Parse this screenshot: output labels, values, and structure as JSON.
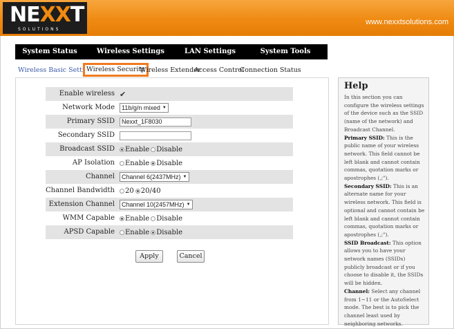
{
  "header": {
    "logo_main": "NE",
    "logo_x": "XX",
    "logo_end": "T",
    "logo_sub": "SOLUTIONS",
    "url": "www.nexxtsolutions.com"
  },
  "main_nav": [
    "System Status",
    "Wireless Settings",
    "LAN Settings",
    "System Tools"
  ],
  "sub_nav": [
    "Wireless Basic Settings",
    "Wireless Security",
    "Wireless Extender",
    "Access Control",
    "Connection Status"
  ],
  "form": {
    "enable_wireless": {
      "label": "Enable wireless",
      "checked": "✔"
    },
    "network_mode": {
      "label": "Network Mode",
      "value": "11b/g/n mixed"
    },
    "primary_ssid": {
      "label": "Primary SSID",
      "value": "Nexxt_1F8030"
    },
    "secondary_ssid": {
      "label": "Secondary SSID",
      "value": ""
    },
    "broadcast_ssid": {
      "label": "Broadcast SSID",
      "opt1": "Enable",
      "opt2": "Disable"
    },
    "ap_isolation": {
      "label": "AP Isolation",
      "opt1": "Enable",
      "opt2": "Disable"
    },
    "channel": {
      "label": "Channel",
      "value": "Channel 6(2437MHz)"
    },
    "channel_bandwidth": {
      "label": "Channel Bandwidth",
      "opt1": "20",
      "opt2": "20/40"
    },
    "extension_channel": {
      "label": "Extension Channel",
      "value": "Channel 10(2457MHz)"
    },
    "wmm_capable": {
      "label": "WMM Capable",
      "opt1": "Enable",
      "opt2": "Disable"
    },
    "apsd_capable": {
      "label": "APSD Capable",
      "opt1": "Enable",
      "opt2": "Disable"
    }
  },
  "buttons": {
    "apply": "Apply",
    "cancel": "Cancel"
  },
  "help": {
    "title": "Help",
    "intro": "In this section you can configure the wireless settings of the device such as the SSID (name of the network) and Broadcast Channel.",
    "primary_head": "Primary SSID:",
    "primary_text": " This is the public name of your wireless network. This field cannot be left blank and cannot contain commas, quotation marks or apostrophes (,;\").",
    "secondary_head": "Secondary SSID:",
    "secondary_text": " This is an alternate name for your wireless network. This field is optional and cannot contain be left blank and cannot contain commas, quotation marks or apostrophes (,;\").",
    "broadcast_head": "SSID Broadcast:",
    "broadcast_text": " This option allows you to have your network names (SSIDs) publicly broadcast or if you choose to disable it, the SSIDs will be hidden.",
    "channel_head": "Channel:",
    "channel_text": " Select any channel from 1~11 or the AutoSelect mode. The best is to pick the channel least used by neighboring networks."
  },
  "colors": {
    "accent": "#ef8a12",
    "active_border": "#f07a1e",
    "link": "#3a5aa8"
  }
}
